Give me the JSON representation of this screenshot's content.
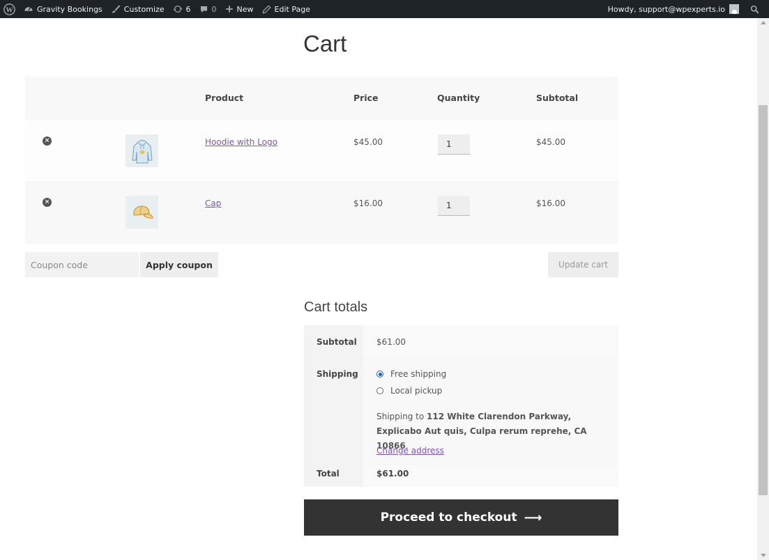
{
  "admin_bar": {
    "site_name": "Gravity Bookings",
    "customize": "Customize",
    "updates_count": "6",
    "comments_count": "0",
    "new": "New",
    "edit_page": "Edit Page",
    "howdy": "Howdy, support@wpexperts.io"
  },
  "page": {
    "title": "Cart"
  },
  "cart": {
    "headers": {
      "product": "Product",
      "price": "Price",
      "quantity": "Quantity",
      "subtotal": "Subtotal"
    },
    "items": [
      {
        "name": "Hoodie with Logo",
        "price": "$45.00",
        "quantity": "1",
        "subtotal": "$45.00",
        "icon": "hoodie-icon"
      },
      {
        "name": "Cap",
        "price": "$16.00",
        "quantity": "1",
        "subtotal": "$16.00",
        "icon": "cap-icon"
      }
    ],
    "coupon_placeholder": "Coupon code",
    "apply_coupon": "Apply coupon",
    "update_cart": "Update cart"
  },
  "totals": {
    "title": "Cart totals",
    "subtotal_label": "Subtotal",
    "subtotal_value": "$61.00",
    "shipping_label": "Shipping",
    "shipping_options": [
      "Free shipping",
      "Local pickup"
    ],
    "shipping_selected": "Free shipping",
    "shipping_to_prefix": "Shipping to",
    "shipping_address": "112 White Clarendon Parkway, Explicabo Aut quis, Culpa rerum reprehe, CA 10866",
    "change_address": "Change address",
    "total_label": "Total",
    "total_value": "$61.00",
    "checkout_label": "Proceed to checkout"
  },
  "colors": {
    "admin_bar": "#1d2327",
    "link": "#7f54b3",
    "checkout_bg": "#333333",
    "radio": "#0a66d8"
  }
}
